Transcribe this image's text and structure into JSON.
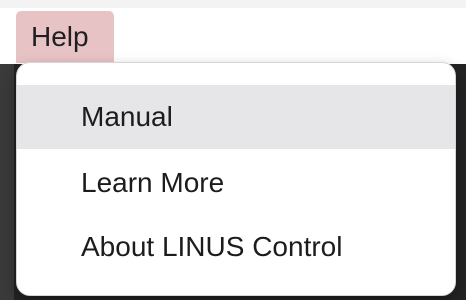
{
  "menubar": {
    "active_menu": "Help"
  },
  "dropdown": {
    "items": [
      {
        "label": "Manual",
        "highlighted": true
      },
      {
        "label": "Learn More",
        "highlighted": false
      },
      {
        "label": "About LINUS Control",
        "highlighted": false
      }
    ]
  },
  "colors": {
    "menu_title_background": "#e8c3c6",
    "highlight_background": "#e6e6e9",
    "backdrop": "#242424"
  }
}
